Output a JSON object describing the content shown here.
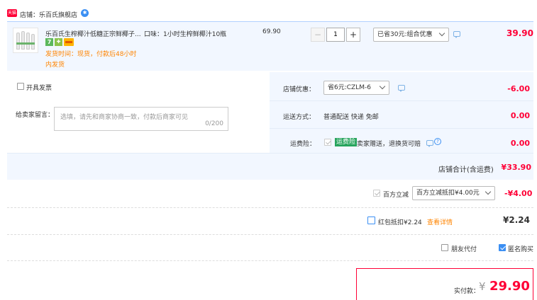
{
  "shop": {
    "badge": "天猫",
    "label": "店铺：乐百氏旗舰店"
  },
  "item": {
    "title": "乐百氏生榨椰汁低糖正宗鲜椰子...",
    "sku": "口味：1小时生榨鲜椰汁10瓶",
    "price": "69.90",
    "quantity": "1",
    "promo_select": "已省30元:组合优惠",
    "subtotal": "39.90",
    "ship_time": "发货时间：现货，付款后48小时",
    "ship_time_2": "内发货"
  },
  "invoice": {
    "label": "开具发票"
  },
  "memo": {
    "label": "给卖家留言：",
    "placeholder": "选填，请先和商家协商一致，付款后商家可见",
    "counter": "0/200"
  },
  "shop_coupon": {
    "label": "店铺优惠：",
    "select": "省6元:CZLM-6",
    "amount": "-6.00"
  },
  "delivery": {
    "label": "运送方式：",
    "value": "普通配送 快递 免邮",
    "amount": "0.00"
  },
  "freight_insurance": {
    "label": "运费险：",
    "tag": "运费险",
    "value": "卖家赠送，退换货可赔",
    "amount": "0.00"
  },
  "shop_total": {
    "label": "店铺合计(含运费)",
    "amount": "¥33.90"
  },
  "platform_discount": {
    "label": "百方立减",
    "select": "百方立减抵扣¥4.00元",
    "amount": "-¥4.00"
  },
  "red_packet": {
    "label": "红包抵扣¥2.24",
    "link": "查看详情",
    "amount": "¥2.24"
  },
  "options": {
    "friend_pay": "朋友代付",
    "anonymous": "匿名购买"
  },
  "pay": {
    "label": "实付款：",
    "currency": "¥",
    "amount": "29.90"
  },
  "colors": {
    "accent": "#ff0036",
    "orange": "#ff8400",
    "panel": "#f2f7ff",
    "link": "#3b8ff3"
  }
}
